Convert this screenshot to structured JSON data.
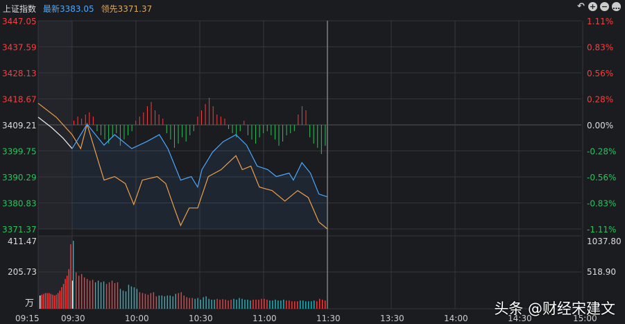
{
  "header": {
    "index_name": "上证指数",
    "latest": "最新3383.05",
    "leading": "领先3371.37"
  },
  "colors": {
    "up": "#ff3b3b",
    "down": "#27c45a",
    "price_line": "#4aa8ff",
    "leading_line": "#f0a04b",
    "volume_down": "#25b8c0",
    "grid": "#34363c"
  },
  "icons": [
    "undo-icon",
    "zoom-in-icon",
    "zoom-out-icon",
    "more-icon"
  ],
  "watermark": "头条 @财经宋建文",
  "chart_data": [
    {
      "type": "line",
      "title": "上证指数 分时",
      "ylim": [
        3371.37,
        3447.05
      ],
      "left_ticks": [
        "3447.05",
        "3437.59",
        "3428.13",
        "3418.67",
        "3409.21",
        "3399.75",
        "3390.29",
        "3380.83",
        "3371.37"
      ],
      "right_ticks": [
        "1.11%",
        "0.83%",
        "0.56%",
        "0.28%",
        "0.00%",
        "-0.28%",
        "-0.56%",
        "-0.83%",
        "-1.11%"
      ],
      "x_ticks": [
        "09:15",
        "09:30",
        "10:00",
        "10:30",
        "11:00",
        "11:30",
        "13:30",
        "14:00",
        "14:30",
        "15:00"
      ],
      "x_unit": "minutes from 09:30 (negative = call auction)",
      "series": [
        {
          "name": "最新",
          "points": [
            [
              -15,
              3412.0
            ],
            [
              -9,
              3408.2
            ],
            [
              -4,
              3404.4
            ],
            [
              0,
              3400.57
            ],
            [
              7,
              3409.46
            ],
            [
              15,
              3401.84
            ],
            [
              20,
              3405.65
            ],
            [
              28,
              3400.57
            ],
            [
              35,
              3403.1
            ],
            [
              41,
              3405.65
            ],
            [
              45,
              3400.57
            ],
            [
              51,
              3389.14
            ],
            [
              56,
              3390.41
            ],
            [
              59,
              3386.6
            ],
            [
              61,
              3392.95
            ],
            [
              66,
              3399.3
            ],
            [
              71,
              3403.1
            ],
            [
              77,
              3405.65
            ],
            [
              82,
              3401.84
            ],
            [
              87,
              3394.22
            ],
            [
              92,
              3392.95
            ],
            [
              96,
              3390.41
            ],
            [
              102,
              3391.68
            ],
            [
              104,
              3389.14
            ],
            [
              108,
              3395.49
            ],
            [
              112,
              3391.68
            ],
            [
              116,
              3384.06
            ],
            [
              120,
              3383.05
            ]
          ]
        },
        {
          "name": "领先",
          "points": [
            [
              -15,
              3417.08
            ],
            [
              -7,
              3412.0
            ],
            [
              0,
              3405.65
            ],
            [
              4,
              3400.57
            ],
            [
              7,
              3409.46
            ],
            [
              12,
              3396.76
            ],
            [
              15,
              3389.14
            ],
            [
              20,
              3390.41
            ],
            [
              25,
              3387.87
            ],
            [
              29,
              3380.25
            ],
            [
              33,
              3389.14
            ],
            [
              40,
              3390.41
            ],
            [
              44,
              3387.87
            ],
            [
              48,
              3378.98
            ],
            [
              51,
              3372.63
            ],
            [
              55,
              3378.98
            ],
            [
              59,
              3378.98
            ],
            [
              64,
              3390.41
            ],
            [
              70,
              3392.95
            ],
            [
              77,
              3398.0
            ],
            [
              80,
              3392.95
            ],
            [
              84,
              3394.22
            ],
            [
              88,
              3386.6
            ],
            [
              94,
              3385.33
            ],
            [
              100,
              3381.52
            ],
            [
              106,
              3385.33
            ],
            [
              111,
              3382.79
            ],
            [
              116,
              3373.9
            ],
            [
              120,
              3371.37
            ]
          ]
        }
      ],
      "breadth_bars": [
        4,
        8,
        6,
        10,
        12,
        8,
        -6,
        -10,
        -14,
        -18,
        -12,
        -8,
        -20,
        -14,
        -10,
        -6,
        4,
        8,
        12,
        18,
        22,
        14,
        10,
        6,
        -8,
        -14,
        -22,
        -18,
        -12,
        -16,
        -10,
        -6,
        8,
        14,
        20,
        26,
        18,
        10,
        8,
        6,
        -4,
        -8,
        -12,
        -6,
        4,
        -10,
        -14,
        -18,
        -12,
        -8,
        -6,
        -10,
        -14,
        -20,
        -16,
        -10,
        -8,
        -6,
        10,
        18,
        14,
        -12,
        -18,
        -22,
        -28,
        -20
      ]
    },
    {
      "type": "bar",
      "title": "成交量",
      "unit": "万",
      "left_ticks": [
        "411.47",
        "205.73"
      ],
      "right_ticks": [
        "1037.80",
        "518.90"
      ],
      "ylim": [
        0,
        411.47
      ],
      "auction_values": [
        80,
        85,
        90,
        95,
        95,
        95,
        90,
        85,
        80,
        85,
        95,
        110,
        130,
        150,
        180,
        200,
        240,
        390,
        170
      ],
      "values": [
        411,
        220,
        200,
        210,
        190,
        180,
        170,
        175,
        160,
        170,
        160,
        165,
        150,
        160,
        170,
        155,
        160,
        120,
        110,
        105,
        145,
        135,
        130,
        120,
        100,
        95,
        90,
        85,
        95,
        100,
        75,
        80,
        80,
        75,
        80,
        80,
        75,
        90,
        95,
        100,
        80,
        70,
        65,
        65,
        60,
        65,
        55,
        70,
        75,
        60,
        55,
        55,
        60,
        55,
        58,
        55,
        50,
        55,
        60,
        55,
        65,
        60,
        55,
        55,
        50,
        55,
        55,
        55,
        60,
        60,
        55,
        50,
        50,
        55,
        50,
        50,
        55,
        50,
        50,
        45,
        45,
        45,
        50,
        50,
        45,
        45,
        45,
        50,
        45,
        60,
        55,
        50
      ],
      "colors": "grrrrrrrggggrrrrrgggggggrrrrrrrgggggggrrrrrrggggggggrrrrrrgggggggrrrrrrggggggrrrrrggggggrrrrrg"
    }
  ]
}
